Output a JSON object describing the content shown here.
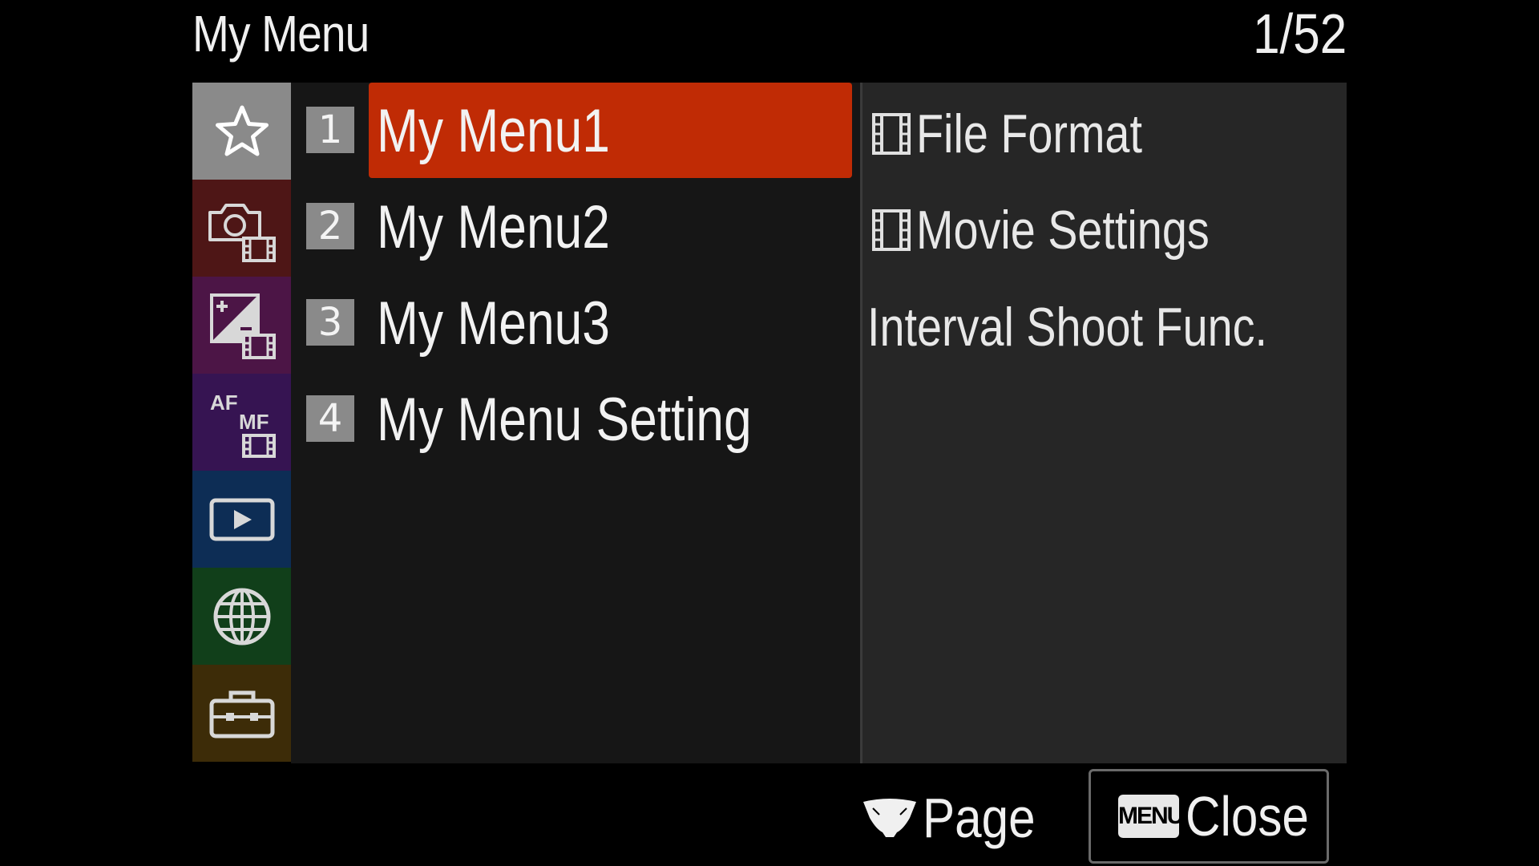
{
  "header": {
    "title": "My Menu",
    "page_counter": "1/52"
  },
  "sidebar": {
    "categories": [
      {
        "name": "my-menu",
        "icon": "star-icon",
        "color": "#8a8a8a",
        "selected": true
      },
      {
        "name": "shooting",
        "icon": "camera-movie-icon",
        "color": "#4e1616"
      },
      {
        "name": "exposure-color",
        "icon": "exposure-movie-icon",
        "color": "#4c1546"
      },
      {
        "name": "focus",
        "icon": "af-mf-movie-icon",
        "color": "#361452"
      },
      {
        "name": "playback",
        "icon": "playback-icon",
        "color": "#0d2d55"
      },
      {
        "name": "network",
        "icon": "globe-icon",
        "color": "#113f1a"
      },
      {
        "name": "setup",
        "icon": "toolbox-icon",
        "color": "#3d2c08"
      }
    ]
  },
  "menu": {
    "items": [
      {
        "number": "1",
        "label": "My Menu1",
        "selected": true
      },
      {
        "number": "2",
        "label": "My Menu2"
      },
      {
        "number": "3",
        "label": "My Menu3"
      },
      {
        "number": "4",
        "label": "My Menu Setting"
      }
    ],
    "highlight_color": "#c02b05"
  },
  "submenu": {
    "items": [
      {
        "label": "File Format",
        "icon": "film-strip-icon"
      },
      {
        "label": "Movie Settings",
        "icon": "film-strip-icon"
      },
      {
        "label": "Interval Shoot Func.",
        "icon": ""
      }
    ]
  },
  "footer": {
    "page_label": "Page",
    "menu_key": "MENU",
    "close_label": "Close"
  }
}
